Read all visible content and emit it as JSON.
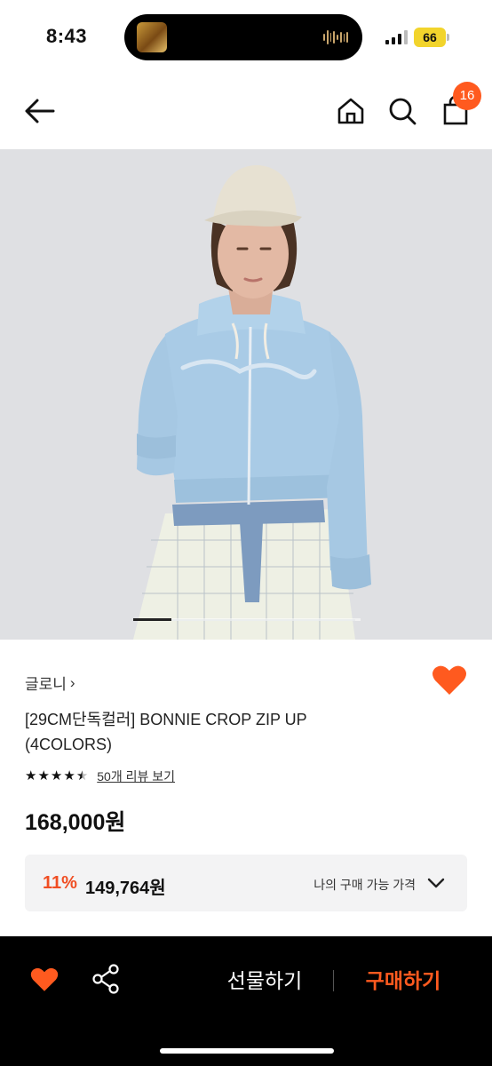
{
  "status_bar": {
    "time": "8:43",
    "battery": "66",
    "island_art_icon": "album-art-icon",
    "island_audio_icon": "audio-wave-icon"
  },
  "nav": {
    "back_icon": "arrow-left-icon",
    "home_icon": "home-icon",
    "search_icon": "search-icon",
    "cart_icon": "shopping-bag-icon",
    "cart_count": "16"
  },
  "product": {
    "image_alt_icon": "product-photo",
    "image_page": 1,
    "image_page_count": 6,
    "brand": "글로니",
    "brand_chevron": "›",
    "title": "[29CM단독컬러] BONNIE CROP ZIP UP (4COLORS)",
    "rating": 4.5,
    "stars": [
      "★",
      "★",
      "★",
      "★",
      "★"
    ],
    "review_link": "50개 리뷰 보기",
    "price": "168,000원",
    "liked": true
  },
  "coupon": {
    "rate": "11%",
    "price": "149,764원",
    "label": "나의 구매 가능 가격"
  },
  "bottom_bar": {
    "gift_label": "선물하기",
    "buy_label": "구매하기"
  },
  "colors": {
    "accent": "#ff5a1f",
    "discount": "#f04e23",
    "bottom_bar_bg": "#000000"
  }
}
